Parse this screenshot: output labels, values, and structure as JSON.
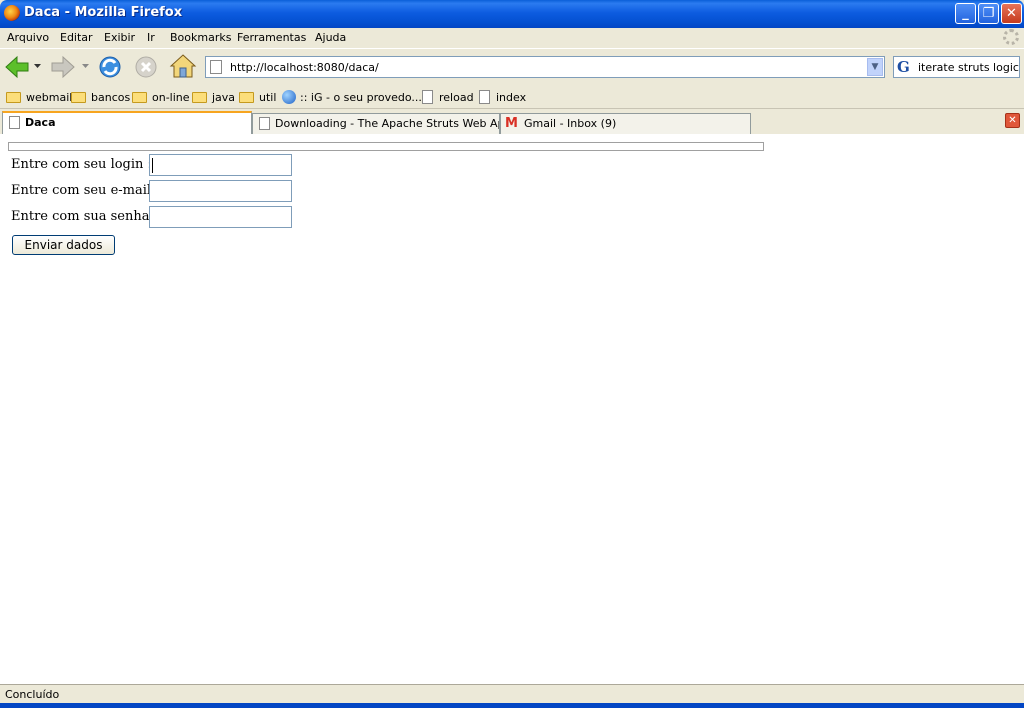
{
  "window": {
    "title": "Daca - Mozilla Firefox"
  },
  "menu": [
    "Arquivo",
    "Editar",
    "Exibir",
    "Ir",
    "Bookmarks",
    "Ferramentas",
    "Ajuda"
  ],
  "navigation": {
    "url": "http://localhost:8080/daca/",
    "search_text": "iterate struts logic",
    "search_engine_glyph": "G"
  },
  "bookmarks": [
    {
      "label": "webmail",
      "icon": "folder-icon"
    },
    {
      "label": "bancos",
      "icon": "folder-icon"
    },
    {
      "label": "on-line",
      "icon": "folder-icon"
    },
    {
      "label": "java",
      "icon": "folder-icon"
    },
    {
      "label": "util",
      "icon": "folder-icon"
    },
    {
      "label": ":: iG - o seu provedo...",
      "icon": "globe-icon"
    },
    {
      "label": "reload",
      "icon": "page-icon"
    },
    {
      "label": "index",
      "icon": "page-icon"
    }
  ],
  "tabs": [
    {
      "label": "Daca",
      "active": true
    },
    {
      "label": "Downloading - The Apache Struts Web Appli...",
      "active": false
    },
    {
      "label": "Gmail - Inbox (9)",
      "active": false
    }
  ],
  "form": {
    "login_label": "Entre com seu login :",
    "email_label": "Entre com seu e-mail :",
    "password_label": "Entre com sua senha:",
    "login_value": "",
    "email_value": "",
    "password_value": "",
    "submit_label": "Enviar dados"
  },
  "status": {
    "text": "Concluído"
  }
}
